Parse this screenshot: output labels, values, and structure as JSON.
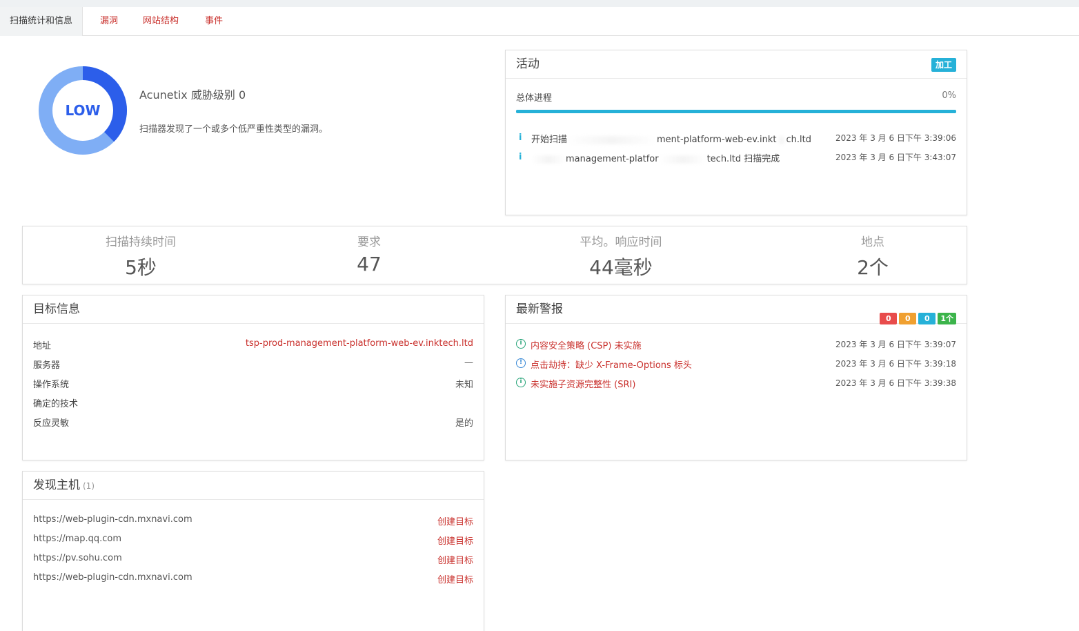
{
  "tabs": [
    "扫描统计和信息",
    "漏洞",
    "网站结构",
    "事件"
  ],
  "threat": {
    "level_label": "LOW",
    "title": "Acunetix 威胁级别 0",
    "description": "扫描器发现了一个或多个低严重性类型的漏洞。",
    "colors": {
      "dark": "#2c5eea",
      "light": "#7faef5"
    }
  },
  "activity": {
    "title": "活动",
    "status_badge": "加工",
    "progress_label": "总体进程",
    "progress_value": "0%",
    "progress_fraction": 1.0,
    "events": [
      {
        "message_prefix": "开始扫描",
        "message_suffix": "ment-platform-web-ev.inkt",
        "message_tail": "ch.ltd",
        "time": "2023 年 3 月 6 日下午 3:39:06"
      },
      {
        "message_prefix": "",
        "message_suffix": "management-platfor",
        "message_tail": "tech.ltd 扫描完成",
        "time": "2023 年 3 月 6 日下午 3:43:07"
      }
    ]
  },
  "stats": [
    {
      "label": "扫描持续时间",
      "value": "5秒"
    },
    {
      "label": "要求",
      "value": "47"
    },
    {
      "label": "平均。响应时间",
      "value": "44毫秒"
    },
    {
      "label": "地点",
      "value": "2个"
    }
  ],
  "target_info": {
    "title": "目标信息",
    "rows": [
      {
        "key": "地址",
        "value": "tsp-prod-management-platform-web-ev.inktech.ltd"
      },
      {
        "key": "服务器",
        "value": "—"
      },
      {
        "key": "操作系统",
        "value": "未知"
      },
      {
        "key": "确定的技术",
        "value": ""
      },
      {
        "key": "反应灵敏",
        "value": "是的"
      }
    ]
  },
  "alerts": {
    "title": "最新警报",
    "severity_counts": [
      {
        "value": "0",
        "color": "#e84c4c"
      },
      {
        "value": "0",
        "color": "#f0a030"
      },
      {
        "value": "0",
        "color": "#26b1d8"
      },
      {
        "value": "1个",
        "color": "#3cb44b"
      }
    ],
    "items": [
      {
        "name": "内容安全策略 (CSP) 未实施",
        "time": "2023 年 3 月 6 日下午 3:39:07",
        "icon": "green"
      },
      {
        "name": "点击劫持：缺少 X-Frame-Options 标头",
        "time": "2023 年 3 月 6 日下午 3:39:18",
        "icon": "blue"
      },
      {
        "name": "未实施子资源完整性 (SRI)",
        "time": "2023 年 3 月 6 日下午 3:39:38",
        "icon": "green"
      }
    ]
  },
  "hosts": {
    "title": "发现主机",
    "count": "(1)",
    "action_label": "创建目标",
    "items": [
      "https://web-plugin-cdn.mxnavi.com",
      "https://map.qq.com",
      "https://pv.sohu.com",
      "https://web-plugin-cdn.mxnavi.com"
    ]
  }
}
